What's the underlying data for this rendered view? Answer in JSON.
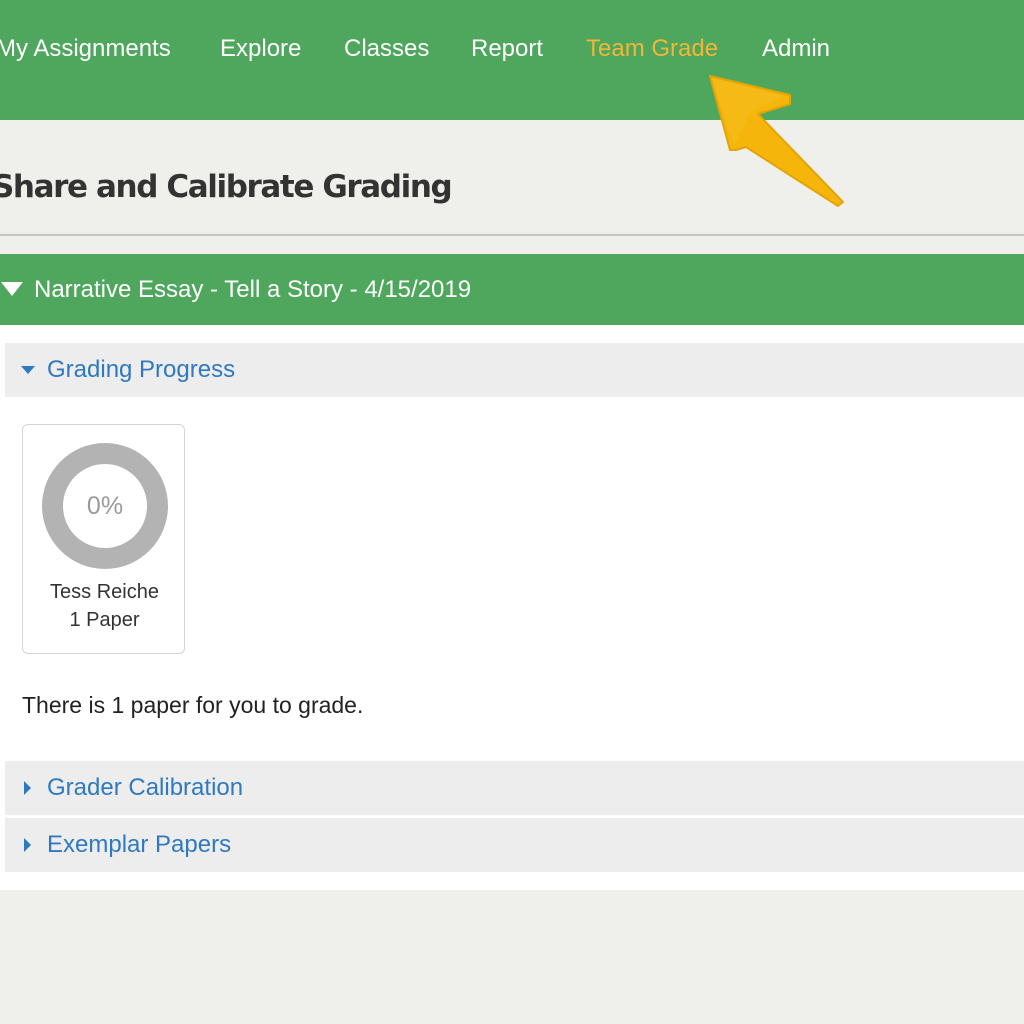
{
  "nav": {
    "items": [
      {
        "label": "My Assignments"
      },
      {
        "label": "Explore"
      },
      {
        "label": "Classes"
      },
      {
        "label": "Report"
      },
      {
        "label": "Team Grade"
      },
      {
        "label": "Admin"
      }
    ],
    "active": "Team Grade"
  },
  "page": {
    "title": "Share and Calibrate Grading"
  },
  "assignment": {
    "title": "Narrative Essay - Tell a Story - 4/15/2019"
  },
  "sections": {
    "grading_progress": {
      "label": "Grading Progress",
      "expanded": true,
      "graders": [
        {
          "name": "Tess Reiche",
          "papers": "1 Paper",
          "progress_percent": 0,
          "progress_label": "0%"
        }
      ],
      "message": "There is 1 paper for you to grade."
    },
    "grader_calibration": {
      "label": "Grader Calibration",
      "expanded": false
    },
    "exemplar_papers": {
      "label": "Exemplar Papers",
      "expanded": false
    }
  },
  "colors": {
    "brand_green": "#4fa65d",
    "active_nav": "#f2b637",
    "link_blue": "#2f79c0",
    "callout_arrow": "#f5b50b",
    "progress_track": "#b3b3b3"
  },
  "icons": {
    "callout": "arrow-pointer-icon",
    "expanded": "caret-down-icon",
    "collapsed": "caret-right-icon"
  }
}
